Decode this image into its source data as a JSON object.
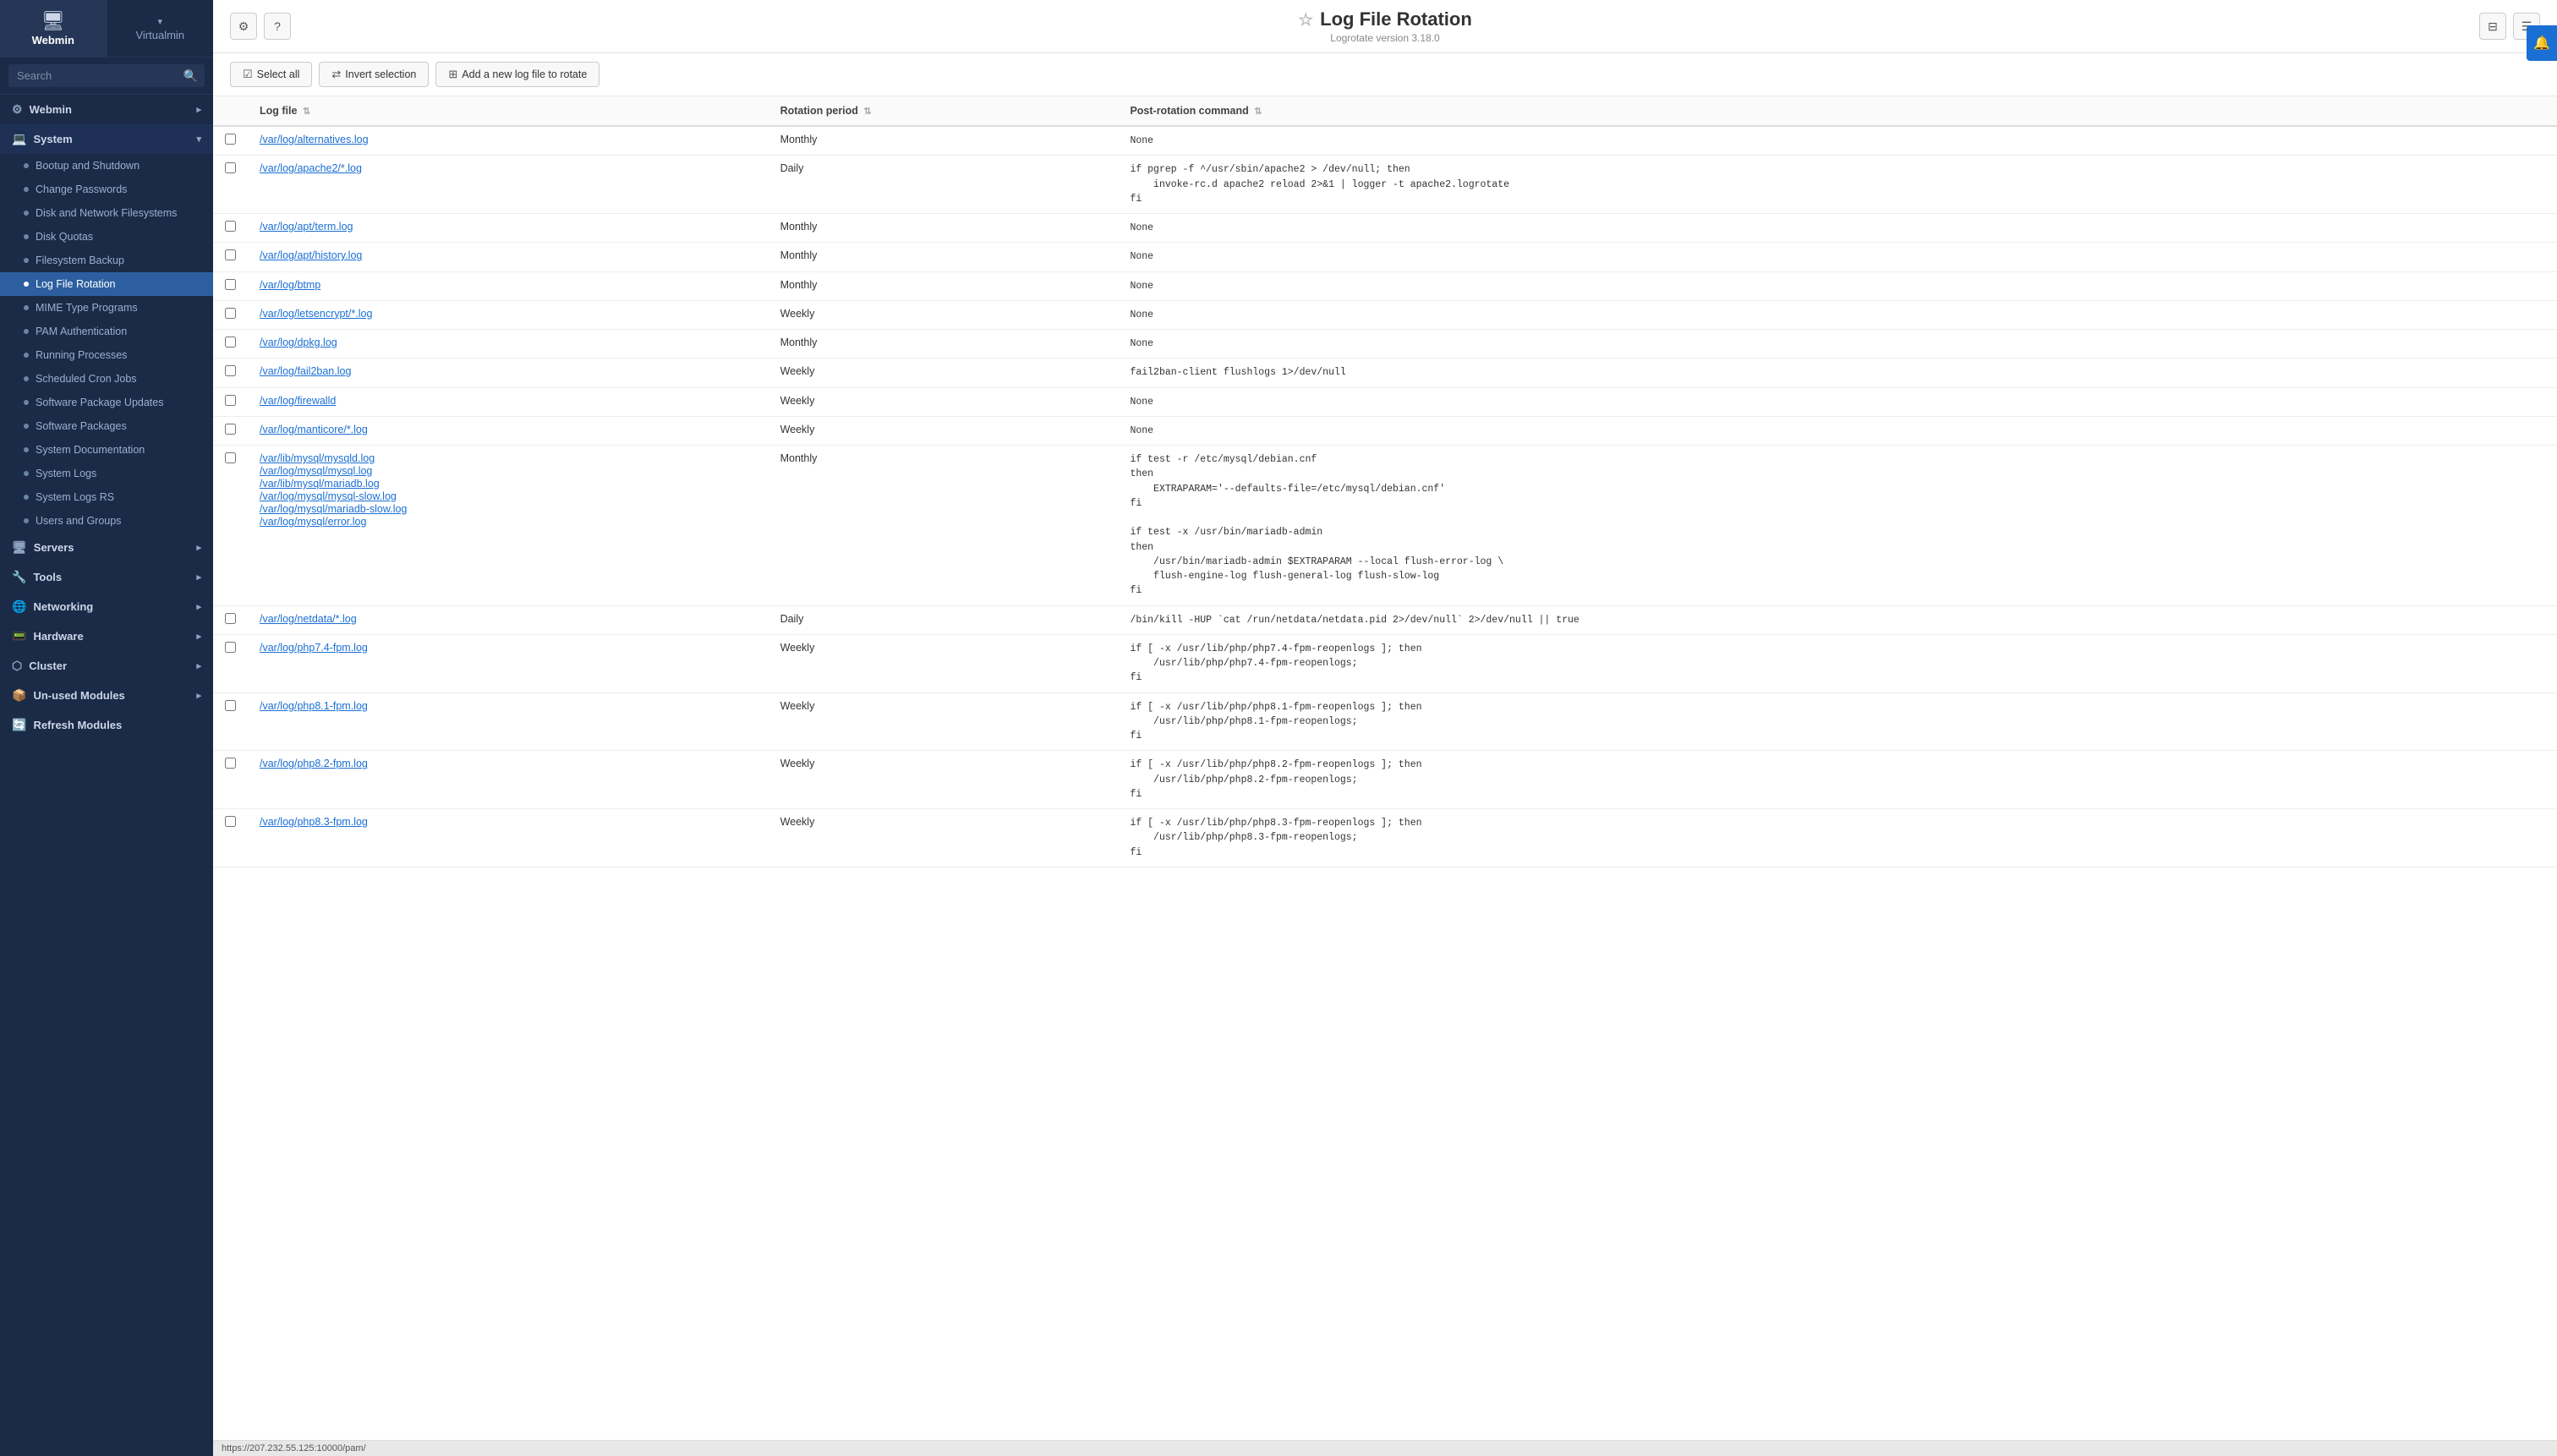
{
  "brand": {
    "webmin_label": "Webmin",
    "webmin_icon": "🖥",
    "virtualmin_label": "Virtualmin",
    "virtualmin_arrow": "▾"
  },
  "search": {
    "placeholder": "Search"
  },
  "sidebar": {
    "top_items": [
      {
        "id": "webmin",
        "label": "Webmin",
        "icon": "⚙",
        "expanded": true
      },
      {
        "id": "system",
        "label": "System",
        "icon": "💻",
        "expanded": true
      },
      {
        "id": "servers",
        "label": "Servers",
        "icon": "🖧",
        "expanded": false
      },
      {
        "id": "tools",
        "label": "Tools",
        "icon": "🔧",
        "expanded": false
      },
      {
        "id": "networking",
        "label": "Networking",
        "icon": "🌐",
        "expanded": false
      },
      {
        "id": "hardware",
        "label": "Hardware",
        "icon": "📟",
        "expanded": false
      },
      {
        "id": "cluster",
        "label": "Cluster",
        "icon": "⬡",
        "expanded": false
      },
      {
        "id": "unused",
        "label": "Un-used Modules",
        "icon": "📦",
        "expanded": false
      },
      {
        "id": "refresh",
        "label": "Refresh Modules",
        "icon": "🔄",
        "expanded": false
      }
    ],
    "system_sub_items": [
      {
        "id": "bootup",
        "label": "Bootup and Shutdown"
      },
      {
        "id": "change-passwords",
        "label": "Change Passwords"
      },
      {
        "id": "disk-network",
        "label": "Disk and Network Filesystems"
      },
      {
        "id": "disk-quotas",
        "label": "Disk Quotas"
      },
      {
        "id": "filesystem-backup",
        "label": "Filesystem Backup"
      },
      {
        "id": "log-file-rotation",
        "label": "Log File Rotation",
        "active": true
      },
      {
        "id": "mime-type",
        "label": "MIME Type Programs"
      },
      {
        "id": "pam-auth",
        "label": "PAM Authentication"
      },
      {
        "id": "running-processes",
        "label": "Running Processes"
      },
      {
        "id": "scheduled-cron",
        "label": "Scheduled Cron Jobs"
      },
      {
        "id": "software-pkg-updates",
        "label": "Software Package Updates"
      },
      {
        "id": "software-packages",
        "label": "Software Packages"
      },
      {
        "id": "system-docs",
        "label": "System Documentation"
      },
      {
        "id": "system-logs",
        "label": "System Logs"
      },
      {
        "id": "system-logs-rs",
        "label": "System Logs RS"
      },
      {
        "id": "users-groups",
        "label": "Users and Groups"
      }
    ]
  },
  "page": {
    "title": "Log File Rotation",
    "subtitle": "Logrotate version 3.18.0",
    "star_icon": "☆"
  },
  "toolbar": {
    "select_all_label": "Select all",
    "invert_selection_label": "Invert selection",
    "add_new_label": "Add a new log file to rotate"
  },
  "table": {
    "headers": [
      {
        "id": "log-file",
        "label": "Log file",
        "sortable": true
      },
      {
        "id": "rotation-period",
        "label": "Rotation period",
        "sortable": true
      },
      {
        "id": "post-rotation-cmd",
        "label": "Post-rotation command",
        "sortable": true
      }
    ],
    "rows": [
      {
        "id": "row-1",
        "log_files": [
          "/var/log/alternatives.log"
        ],
        "rotation": "Monthly",
        "post_cmd": "None"
      },
      {
        "id": "row-2",
        "log_files": [
          "/var/log/apache2/*.log"
        ],
        "rotation": "Daily",
        "post_cmd": "if pgrep -f ^/usr/sbin/apache2 > /dev/null; then\n    invoke-rc.d apache2 reload 2>&1 | logger -t apache2.logrotate\nfi"
      },
      {
        "id": "row-3",
        "log_files": [
          "/var/log/apt/term.log"
        ],
        "rotation": "Monthly",
        "post_cmd": "None"
      },
      {
        "id": "row-4",
        "log_files": [
          "/var/log/apt/history.log"
        ],
        "rotation": "Monthly",
        "post_cmd": "None"
      },
      {
        "id": "row-5",
        "log_files": [
          "/var/log/btmp"
        ],
        "rotation": "Monthly",
        "post_cmd": "None"
      },
      {
        "id": "row-6",
        "log_files": [
          "/var/log/letsencrypt/*.log"
        ],
        "rotation": "Weekly",
        "post_cmd": "None"
      },
      {
        "id": "row-7",
        "log_files": [
          "/var/log/dpkg.log"
        ],
        "rotation": "Monthly",
        "post_cmd": "None"
      },
      {
        "id": "row-8",
        "log_files": [
          "/var/log/fail2ban.log"
        ],
        "rotation": "Weekly",
        "post_cmd": "fail2ban-client flushlogs 1>/dev/null"
      },
      {
        "id": "row-9",
        "log_files": [
          "/var/log/firewalld"
        ],
        "rotation": "Weekly",
        "post_cmd": "None"
      },
      {
        "id": "row-10",
        "log_files": [
          "/var/log/manticore/*.log"
        ],
        "rotation": "Weekly",
        "post_cmd": "None"
      },
      {
        "id": "row-11",
        "log_files": [
          "/var/lib/mysql/mysqld.log",
          "/var/log/mysql/mysql.log",
          "/var/lib/mysql/mariadb.log",
          "/var/log/mysql/mysql-slow.log",
          "/var/log/mysql/mariadb-slow.log",
          "/var/log/mysql/error.log"
        ],
        "rotation": "Monthly",
        "post_cmd": "if test -r /etc/mysql/debian.cnf\nthen\n    EXTRAPARAM='--defaults-file=/etc/mysql/debian.cnf'\nfi\n\nif test -x /usr/bin/mariadb-admin\nthen\n    /usr/bin/mariadb-admin $EXTRAPARAM --local flush-error-log \\\n    flush-engine-log flush-general-log flush-slow-log\nfi"
      },
      {
        "id": "row-12",
        "log_files": [
          "/var/log/netdata/*.log"
        ],
        "rotation": "Daily",
        "post_cmd": "/bin/kill -HUP `cat /run/netdata/netdata.pid 2>/dev/null` 2>/dev/null || true"
      },
      {
        "id": "row-13",
        "log_files": [
          "/var/log/php7.4-fpm.log"
        ],
        "rotation": "Weekly",
        "post_cmd": "if [ -x /usr/lib/php/php7.4-fpm-reopenlogs ]; then\n    /usr/lib/php/php7.4-fpm-reopenlogs;\nfi"
      },
      {
        "id": "row-14",
        "log_files": [
          "/var/log/php8.1-fpm.log"
        ],
        "rotation": "Weekly",
        "post_cmd": "if [ -x /usr/lib/php/php8.1-fpm-reopenlogs ]; then\n    /usr/lib/php/php8.1-fpm-reopenlogs;\nfi"
      },
      {
        "id": "row-15",
        "log_files": [
          "/var/log/php8.2-fpm.log"
        ],
        "rotation": "Weekly",
        "post_cmd": "if [ -x /usr/lib/php/php8.2-fpm-reopenlogs ]; then\n    /usr/lib/php/php8.2-fpm-reopenlogs;\nfi"
      },
      {
        "id": "row-16",
        "log_files": [
          "/var/log/php8.3-fpm.log"
        ],
        "rotation": "Weekly",
        "post_cmd": "if [ -x /usr/lib/php/php8.3-fpm-reopenlogs ]; then\n    /usr/lib/php/php8.3-fpm-reopenlogs;\nfi"
      }
    ]
  },
  "statusbar": {
    "url": "https://207.232.55.125:10000/pam/"
  }
}
